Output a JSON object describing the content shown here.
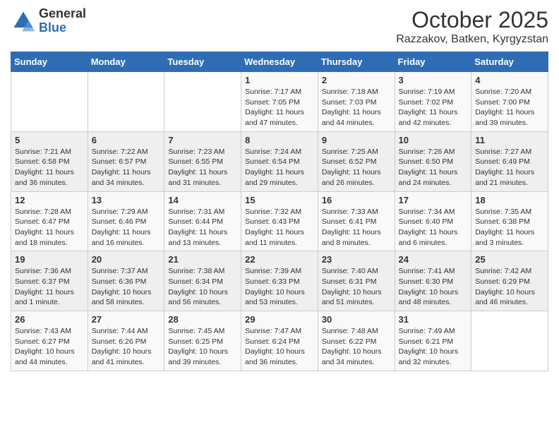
{
  "header": {
    "logo": {
      "general": "General",
      "blue": "Blue"
    },
    "title": "October 2025",
    "subtitle": "Razzakov, Batken, Kyrgyzstan"
  },
  "calendar": {
    "days_of_week": [
      "Sunday",
      "Monday",
      "Tuesday",
      "Wednesday",
      "Thursday",
      "Friday",
      "Saturday"
    ],
    "weeks": [
      [
        {
          "day": "",
          "sunrise": "",
          "sunset": "",
          "daylight": ""
        },
        {
          "day": "",
          "sunrise": "",
          "sunset": "",
          "daylight": ""
        },
        {
          "day": "",
          "sunrise": "",
          "sunset": "",
          "daylight": ""
        },
        {
          "day": "1",
          "sunrise": "Sunrise: 7:17 AM",
          "sunset": "Sunset: 7:05 PM",
          "daylight": "Daylight: 11 hours and 47 minutes."
        },
        {
          "day": "2",
          "sunrise": "Sunrise: 7:18 AM",
          "sunset": "Sunset: 7:03 PM",
          "daylight": "Daylight: 11 hours and 44 minutes."
        },
        {
          "day": "3",
          "sunrise": "Sunrise: 7:19 AM",
          "sunset": "Sunset: 7:02 PM",
          "daylight": "Daylight: 11 hours and 42 minutes."
        },
        {
          "day": "4",
          "sunrise": "Sunrise: 7:20 AM",
          "sunset": "Sunset: 7:00 PM",
          "daylight": "Daylight: 11 hours and 39 minutes."
        }
      ],
      [
        {
          "day": "5",
          "sunrise": "Sunrise: 7:21 AM",
          "sunset": "Sunset: 6:58 PM",
          "daylight": "Daylight: 11 hours and 36 minutes."
        },
        {
          "day": "6",
          "sunrise": "Sunrise: 7:22 AM",
          "sunset": "Sunset: 6:57 PM",
          "daylight": "Daylight: 11 hours and 34 minutes."
        },
        {
          "day": "7",
          "sunrise": "Sunrise: 7:23 AM",
          "sunset": "Sunset: 6:55 PM",
          "daylight": "Daylight: 11 hours and 31 minutes."
        },
        {
          "day": "8",
          "sunrise": "Sunrise: 7:24 AM",
          "sunset": "Sunset: 6:54 PM",
          "daylight": "Daylight: 11 hours and 29 minutes."
        },
        {
          "day": "9",
          "sunrise": "Sunrise: 7:25 AM",
          "sunset": "Sunset: 6:52 PM",
          "daylight": "Daylight: 11 hours and 26 minutes."
        },
        {
          "day": "10",
          "sunrise": "Sunrise: 7:26 AM",
          "sunset": "Sunset: 6:50 PM",
          "daylight": "Daylight: 11 hours and 24 minutes."
        },
        {
          "day": "11",
          "sunrise": "Sunrise: 7:27 AM",
          "sunset": "Sunset: 6:49 PM",
          "daylight": "Daylight: 11 hours and 21 minutes."
        }
      ],
      [
        {
          "day": "12",
          "sunrise": "Sunrise: 7:28 AM",
          "sunset": "Sunset: 6:47 PM",
          "daylight": "Daylight: 11 hours and 18 minutes."
        },
        {
          "day": "13",
          "sunrise": "Sunrise: 7:29 AM",
          "sunset": "Sunset: 6:46 PM",
          "daylight": "Daylight: 11 hours and 16 minutes."
        },
        {
          "day": "14",
          "sunrise": "Sunrise: 7:31 AM",
          "sunset": "Sunset: 6:44 PM",
          "daylight": "Daylight: 11 hours and 13 minutes."
        },
        {
          "day": "15",
          "sunrise": "Sunrise: 7:32 AM",
          "sunset": "Sunset: 6:43 PM",
          "daylight": "Daylight: 11 hours and 11 minutes."
        },
        {
          "day": "16",
          "sunrise": "Sunrise: 7:33 AM",
          "sunset": "Sunset: 6:41 PM",
          "daylight": "Daylight: 11 hours and 8 minutes."
        },
        {
          "day": "17",
          "sunrise": "Sunrise: 7:34 AM",
          "sunset": "Sunset: 6:40 PM",
          "daylight": "Daylight: 11 hours and 6 minutes."
        },
        {
          "day": "18",
          "sunrise": "Sunrise: 7:35 AM",
          "sunset": "Sunset: 6:38 PM",
          "daylight": "Daylight: 11 hours and 3 minutes."
        }
      ],
      [
        {
          "day": "19",
          "sunrise": "Sunrise: 7:36 AM",
          "sunset": "Sunset: 6:37 PM",
          "daylight": "Daylight: 11 hours and 1 minute."
        },
        {
          "day": "20",
          "sunrise": "Sunrise: 7:37 AM",
          "sunset": "Sunset: 6:36 PM",
          "daylight": "Daylight: 10 hours and 58 minutes."
        },
        {
          "day": "21",
          "sunrise": "Sunrise: 7:38 AM",
          "sunset": "Sunset: 6:34 PM",
          "daylight": "Daylight: 10 hours and 56 minutes."
        },
        {
          "day": "22",
          "sunrise": "Sunrise: 7:39 AM",
          "sunset": "Sunset: 6:33 PM",
          "daylight": "Daylight: 10 hours and 53 minutes."
        },
        {
          "day": "23",
          "sunrise": "Sunrise: 7:40 AM",
          "sunset": "Sunset: 6:31 PM",
          "daylight": "Daylight: 10 hours and 51 minutes."
        },
        {
          "day": "24",
          "sunrise": "Sunrise: 7:41 AM",
          "sunset": "Sunset: 6:30 PM",
          "daylight": "Daylight: 10 hours and 48 minutes."
        },
        {
          "day": "25",
          "sunrise": "Sunrise: 7:42 AM",
          "sunset": "Sunset: 6:29 PM",
          "daylight": "Daylight: 10 hours and 46 minutes."
        }
      ],
      [
        {
          "day": "26",
          "sunrise": "Sunrise: 7:43 AM",
          "sunset": "Sunset: 6:27 PM",
          "daylight": "Daylight: 10 hours and 44 minutes."
        },
        {
          "day": "27",
          "sunrise": "Sunrise: 7:44 AM",
          "sunset": "Sunset: 6:26 PM",
          "daylight": "Daylight: 10 hours and 41 minutes."
        },
        {
          "day": "28",
          "sunrise": "Sunrise: 7:45 AM",
          "sunset": "Sunset: 6:25 PM",
          "daylight": "Daylight: 10 hours and 39 minutes."
        },
        {
          "day": "29",
          "sunrise": "Sunrise: 7:47 AM",
          "sunset": "Sunset: 6:24 PM",
          "daylight": "Daylight: 10 hours and 36 minutes."
        },
        {
          "day": "30",
          "sunrise": "Sunrise: 7:48 AM",
          "sunset": "Sunset: 6:22 PM",
          "daylight": "Daylight: 10 hours and 34 minutes."
        },
        {
          "day": "31",
          "sunrise": "Sunrise: 7:49 AM",
          "sunset": "Sunset: 6:21 PM",
          "daylight": "Daylight: 10 hours and 32 minutes."
        },
        {
          "day": "",
          "sunrise": "",
          "sunset": "",
          "daylight": ""
        }
      ]
    ]
  }
}
